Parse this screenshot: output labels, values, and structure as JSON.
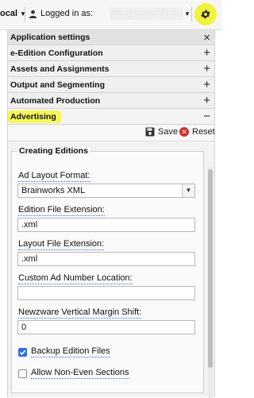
{
  "topbar": {
    "location": "ocal",
    "logged_in_label": "Logged in as:",
    "email": "user@example.com"
  },
  "panel": {
    "sections": [
      {
        "label": "Application settings",
        "action": "×"
      },
      {
        "label": "e-Edition Configuration",
        "action": "+"
      },
      {
        "label": "Assets and Assignments",
        "action": "+"
      },
      {
        "label": "Output and Segmenting",
        "action": "+"
      },
      {
        "label": "Automated Production",
        "action": "+"
      },
      {
        "label": "Advertising",
        "action": "−"
      }
    ],
    "save_label": "Save",
    "reset_label": "Reset"
  },
  "form": {
    "legend": "Creating Editions",
    "ad_layout_label": "Ad Layout Format:",
    "ad_layout_value": "Brainworks XML",
    "edition_ext_label": "Edition File Extension:",
    "edition_ext_value": ".xml",
    "layout_ext_label": "Layout File Extension:",
    "layout_ext_value": ".xml",
    "custom_ad_label": "Custom Ad Number Location:",
    "custom_ad_value": "",
    "newzware_label": "Newzware Vertical Margin Shift:",
    "newzware_value": "0",
    "backup_label": "Backup Edition Files",
    "backup_checked": true,
    "non_even_label": "Allow Non-Even Sections",
    "non_even_checked": false
  },
  "colors": {
    "highlight": "#f6f65a",
    "accent": "#2f6fe0",
    "reset": "#d52b2b"
  }
}
